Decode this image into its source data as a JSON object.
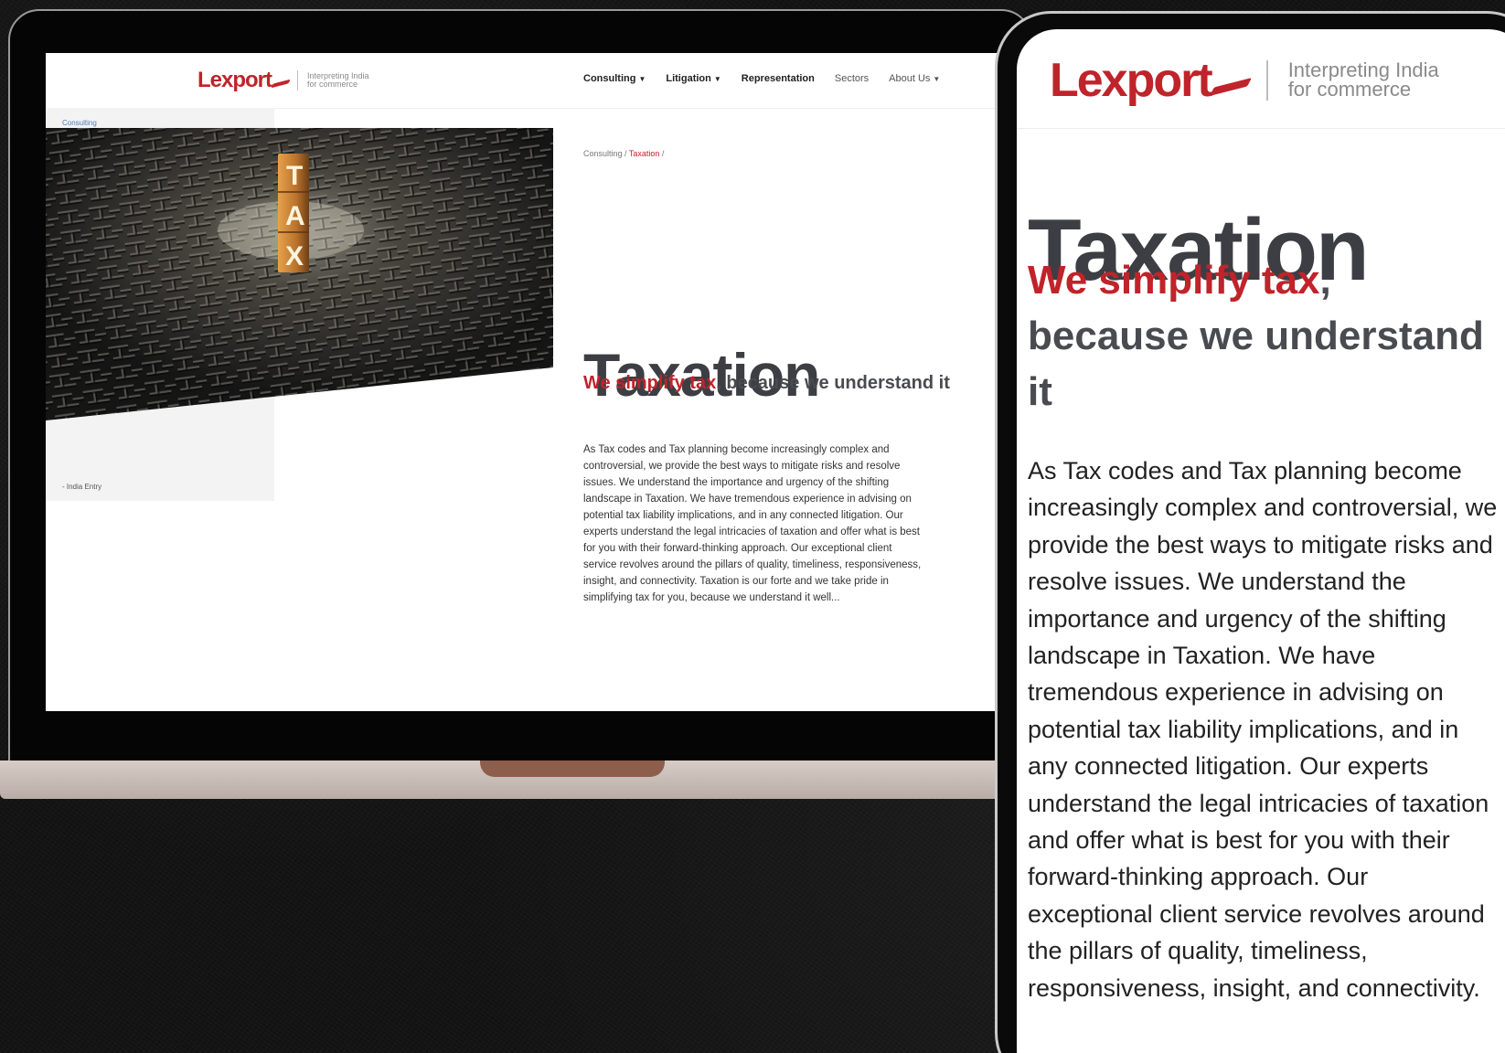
{
  "brand": {
    "logo_text": "Lexport",
    "tagline_line1": "Interpreting India",
    "tagline_line2": "for commerce",
    "accent_color": "#c0232a"
  },
  "nav": {
    "items": [
      {
        "label": "Consulting",
        "has_caret": true
      },
      {
        "label": "Litigation",
        "has_caret": true
      },
      {
        "label": "Representation",
        "has_caret": false
      },
      {
        "label": "Sectors",
        "has_caret": false
      },
      {
        "label": "About Us",
        "has_caret": true
      }
    ]
  },
  "sidebar": {
    "link": "Consulting",
    "partial_item": "- India Entry"
  },
  "hero_image": {
    "icon": "tax-maze-image",
    "letters": [
      "T",
      "A",
      "X"
    ]
  },
  "breadcrumb": {
    "parent": "Consulting",
    "separator": " / ",
    "current": "Taxation",
    "trailing": " /"
  },
  "page": {
    "title": "Taxation",
    "subtitle_highlight": "We simplify tax",
    "subtitle_rest": ", because we understand it",
    "body": "As Tax codes and Tax planning become increasingly complex and controversial, we provide the best ways to mitigate risks and resolve issues. We understand the importance and urgency of the shifting landscape in Taxation. We have tremendous experience in advising on potential tax liability implications, and in any connected litigation. Our experts understand the legal intricacies of taxation and offer what is best for you with their forward-thinking approach. Our exceptional client service revolves around the pillars of quality, timeliness, responsiveness, insight, and connectivity. Taxation is our forte and we take pride in simplifying tax for you, because we understand it well..."
  }
}
